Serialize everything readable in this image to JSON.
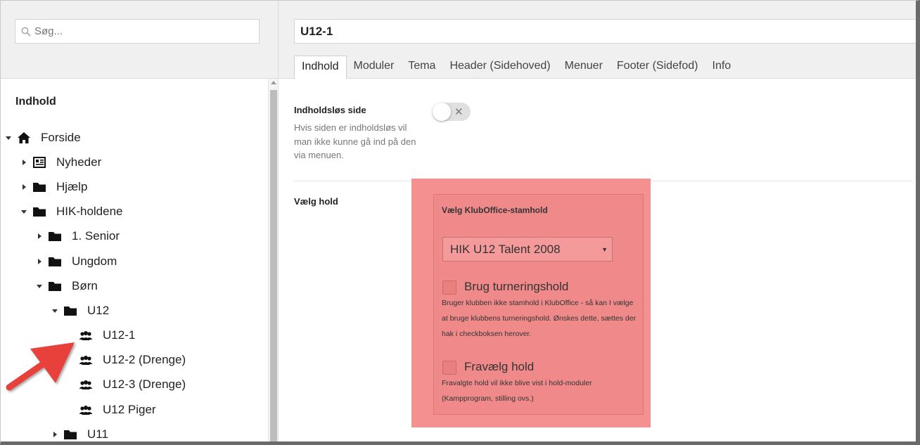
{
  "sidebar": {
    "search_placeholder": "Søg...",
    "heading": "Indhold",
    "tree": [
      {
        "label": "Forside",
        "icon": "home-icon",
        "level": 0,
        "expanded": true
      },
      {
        "label": "Nyheder",
        "icon": "news-icon",
        "level": 1,
        "expanded": false
      },
      {
        "label": "Hjælp",
        "icon": "folder-icon",
        "level": 1,
        "expanded": false
      },
      {
        "label": "HIK-holdene",
        "icon": "folder-icon",
        "level": 1,
        "expanded": true
      },
      {
        "label": "1. Senior",
        "icon": "folder-icon",
        "level": 2,
        "expanded": false
      },
      {
        "label": "Ungdom",
        "icon": "folder-icon",
        "level": 2,
        "expanded": false
      },
      {
        "label": "Børn",
        "icon": "folder-icon",
        "level": 2,
        "expanded": true
      },
      {
        "label": "U12",
        "icon": "folder-icon",
        "level": 3,
        "expanded": true
      },
      {
        "label": "U12-1",
        "icon": "team-icon",
        "level": 4,
        "expanded": null
      },
      {
        "label": "U12-2 (Drenge)",
        "icon": "team-icon",
        "level": 4,
        "expanded": null
      },
      {
        "label": "U12-3 (Drenge)",
        "icon": "team-icon",
        "level": 4,
        "expanded": null
      },
      {
        "label": "U12 Piger",
        "icon": "team-icon",
        "level": 4,
        "expanded": null
      },
      {
        "label": "U11",
        "icon": "folder-icon",
        "level": 3,
        "expanded": false
      }
    ]
  },
  "editor": {
    "page_title": "U12-1",
    "tabs": [
      "Indhold",
      "Moduler",
      "Tema",
      "Header (Sidehoved)",
      "Menuer",
      "Footer (Sidefod)",
      "Info"
    ],
    "active_tab": "Indhold",
    "contentless": {
      "label": "Indholdsløs side",
      "description": "Hvis siden er indholdsløs vil man ikke kunne gå ind på den via menuen.",
      "toggle_symbol": "✕",
      "enabled": false
    },
    "team": {
      "label": "Vælg hold",
      "section_title": "Vælg KlubOffice-stamhold",
      "selected_team": "HIK U12 Talent 2008",
      "tournament_label": "Brug turneringshold",
      "tournament_desc": "Bruger klubben ikke stamhold i KlubOffice - så kan I vælge at bruge klubbens turneringshold. Ønskes dette, sættes der hak i checkboksen herover.",
      "deselect_label": "Fravælg hold",
      "deselect_desc": "Fravalgte hold vil ikke blive vist i hold-moduler (Kampprogram, stilling ovs.)"
    }
  },
  "colors": {
    "highlight": "#f59090",
    "arrow": "#e8403a"
  }
}
